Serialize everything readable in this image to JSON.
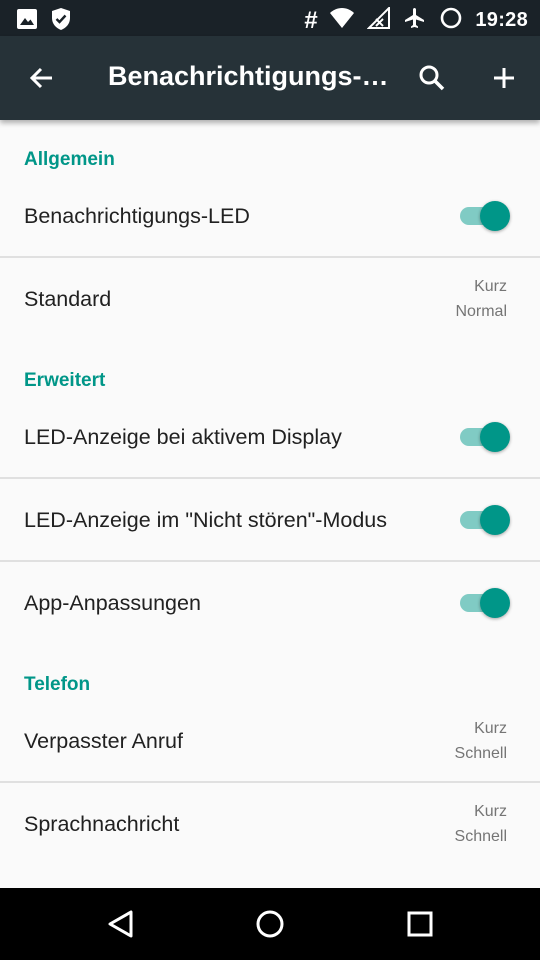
{
  "status_bar": {
    "time": "19:28",
    "hash_symbol": "#",
    "left_icons": [
      "image-icon",
      "shield-check-icon"
    ],
    "right_icons": [
      "hash-icon",
      "wifi-icon",
      "no-signal-icon",
      "airplane-icon",
      "sync-icon"
    ]
  },
  "app_bar": {
    "title": "Benachrichtigungs-LED",
    "back_icon": "arrow-back-icon",
    "search_icon": "search-icon",
    "add_icon": "add-icon"
  },
  "sections": {
    "general": {
      "header": "Allgemein",
      "notification_led": {
        "title": "Benachrichtigungs-LED",
        "enabled": true
      },
      "standard": {
        "title": "Standard",
        "sub1": "Kurz",
        "sub2": "Normal"
      }
    },
    "advanced": {
      "header": "Erweitert",
      "active_display": {
        "title": "LED-Anzeige bei aktivem Display",
        "enabled": true
      },
      "dnd_mode": {
        "title": "LED-Anzeige im \"Nicht stören\"-Modus",
        "enabled": true
      },
      "app_customizations": {
        "title": "App-Anpassungen",
        "enabled": true
      }
    },
    "phone": {
      "header": "Telefon",
      "missed_call": {
        "title": "Verpasster Anruf",
        "sub1": "Kurz",
        "sub2": "Schnell"
      },
      "voicemail": {
        "title": "Sprachnachricht",
        "sub1": "Kurz",
        "sub2": "Schnell"
      }
    }
  },
  "nav_bar": {
    "back_icon": "nav-back-icon",
    "home_icon": "nav-home-icon",
    "recents_icon": "nav-recents-icon"
  },
  "colors": {
    "accent": "#009688",
    "accent_light": "#80cbc4",
    "app_bar": "#263238",
    "status_bar": "#1a2228"
  }
}
